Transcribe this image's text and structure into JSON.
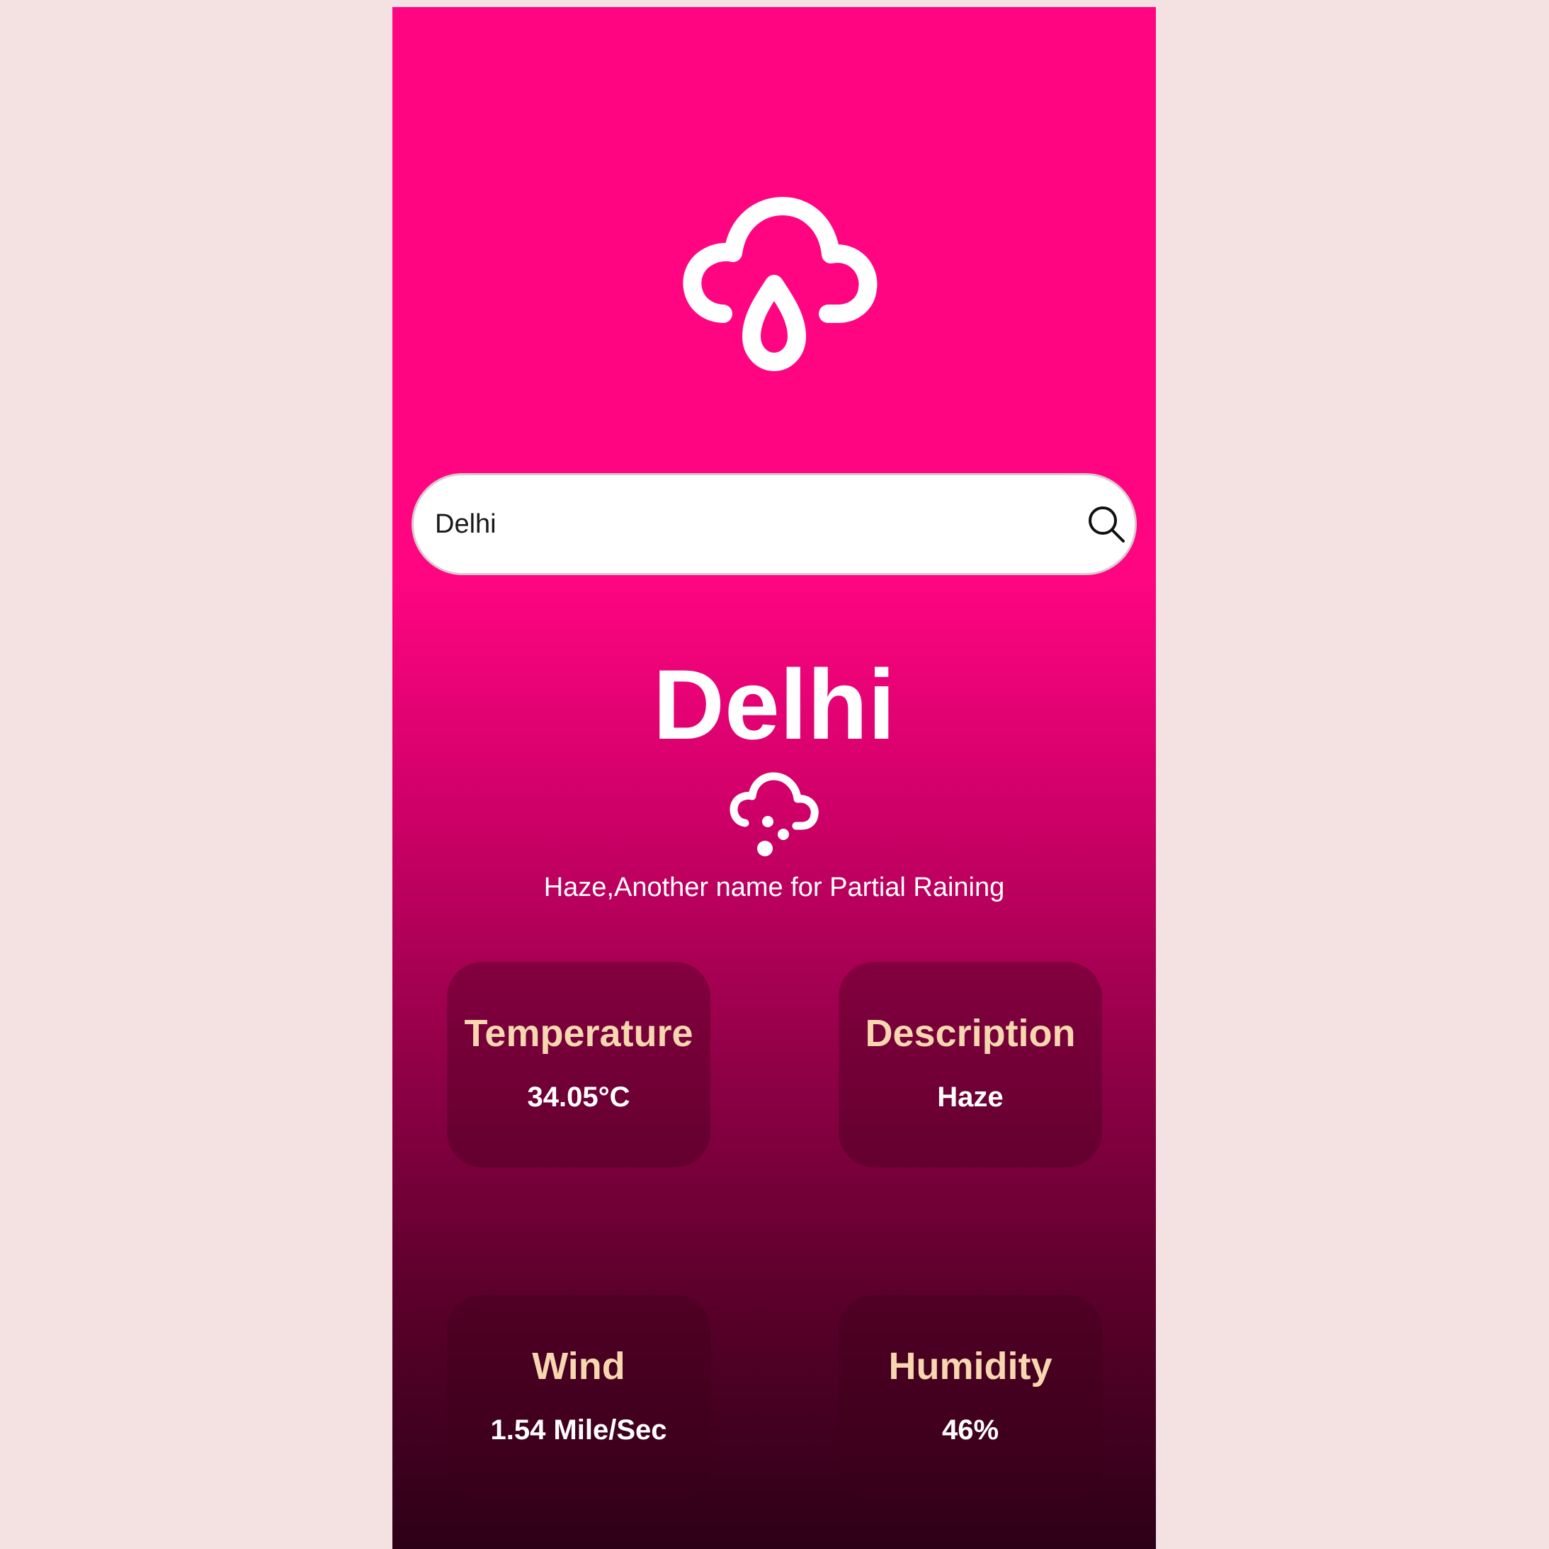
{
  "search": {
    "value": "Delhi",
    "placeholder": ""
  },
  "location": {
    "city": "Delhi",
    "description": "Haze,Another name for Partial Raining"
  },
  "stats": {
    "temperature": {
      "label": "Temperature",
      "value": "34.05°C"
    },
    "description": {
      "label": "Description",
      "value": "Haze"
    },
    "wind": {
      "label": "Wind",
      "value": "1.54 Mile/Sec"
    },
    "humidity": {
      "label": "Humidity",
      "value": "46%"
    }
  },
  "icons": {
    "hero": "cloud-rain-drop-icon",
    "search": "search-icon",
    "condition": "cloud-hail-icon"
  },
  "colors": {
    "page_background": "#f4e2e2",
    "gradient_top": "#ff0582",
    "gradient_bottom": "#2c0017",
    "card_title": "#f7d7b0",
    "text": "#ffffff"
  }
}
